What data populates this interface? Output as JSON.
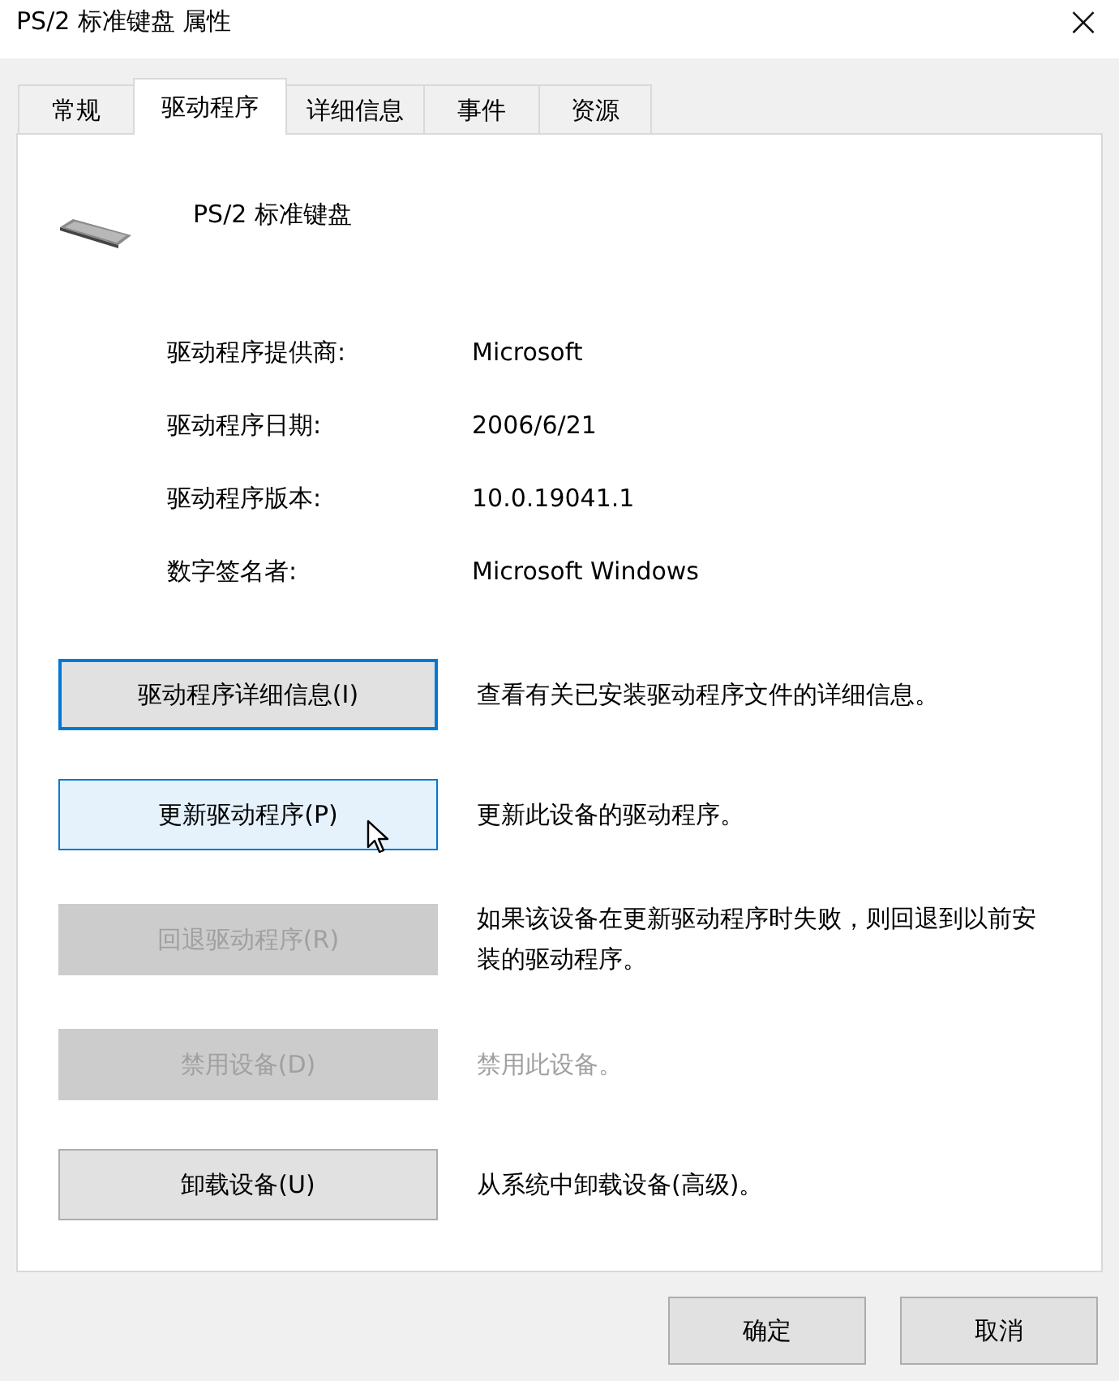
{
  "window": {
    "title": "PS/2 标准键盘 属性",
    "close": "×"
  },
  "tabs": [
    {
      "label": "常规",
      "selected": false
    },
    {
      "label": "驱动程序",
      "selected": true
    },
    {
      "label": "详细信息",
      "selected": false
    },
    {
      "label": "事件",
      "selected": false
    },
    {
      "label": "资源",
      "selected": false
    }
  ],
  "device": {
    "name": "PS/2 标准键盘"
  },
  "properties": [
    {
      "label": "驱动程序提供商:",
      "value": "Microsoft"
    },
    {
      "label": "驱动程序日期:",
      "value": "2006/6/21"
    },
    {
      "label": "驱动程序版本:",
      "value": "10.0.19041.1"
    },
    {
      "label": "数字签名者:",
      "value": "Microsoft Windows"
    }
  ],
  "actions": [
    {
      "button": "驱动程序详细信息(I)",
      "description": "查看有关已安装驱动程序文件的详细信息。",
      "disabled": false,
      "focused": true,
      "hovered": false
    },
    {
      "button": "更新驱动程序(P)",
      "description": "更新此设备的驱动程序。",
      "disabled": false,
      "focused": false,
      "hovered": true
    },
    {
      "button": "回退驱动程序(R)",
      "description": "如果该设备在更新驱动程序时失败，则回退到以前安装的驱动程序。",
      "description_dimmed": false,
      "disabled": true,
      "focused": false,
      "hovered": false
    },
    {
      "button": "禁用设备(D)",
      "description": "禁用此设备。",
      "description_dimmed": true,
      "disabled": true,
      "focused": false,
      "hovered": false
    },
    {
      "button": "卸载设备(U)",
      "description": "从系统中卸载设备(高级)。",
      "disabled": false,
      "focused": false,
      "hovered": false
    }
  ],
  "footer_buttons": [
    "确定",
    "取消"
  ]
}
